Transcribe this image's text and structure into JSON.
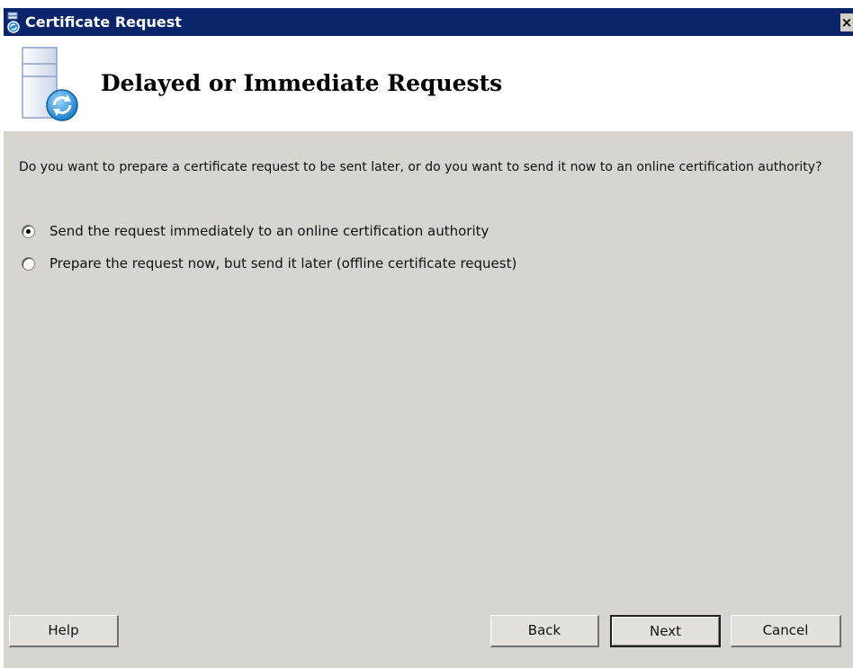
{
  "window": {
    "title": "Certificate Request",
    "close_label": "×"
  },
  "header": {
    "title": "Delayed or Immediate Requests"
  },
  "body": {
    "question": "Do you want to prepare a certificate request to be sent later, or do you want to send it now to an online certification authority?",
    "options": [
      {
        "label": "Send the request immediately to an online certification authority",
        "selected": true
      },
      {
        "label": "Prepare the request now, but send it later (offline certificate request)",
        "selected": false
      }
    ]
  },
  "buttons": {
    "help": "Help",
    "back": "Back",
    "next": "Next",
    "cancel": "Cancel"
  },
  "colors": {
    "titlebar": "#0a246a",
    "dialog_background": "#d8d5d0",
    "header_background": "#ffffff"
  },
  "icons": {
    "title": "certificate-request-icon",
    "header": "server-sync-icon"
  }
}
